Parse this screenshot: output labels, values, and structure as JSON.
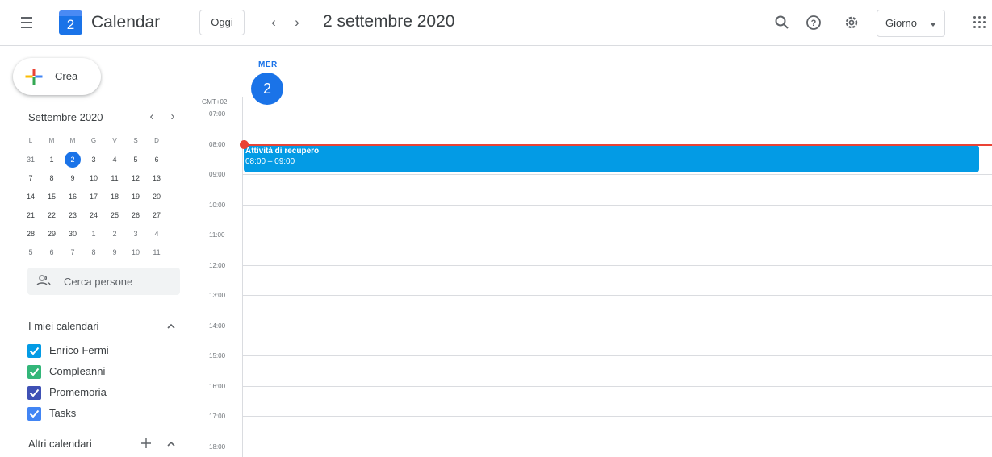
{
  "header": {
    "app_title": "Calendar",
    "logo_day": "2",
    "today_label": "Oggi",
    "date_title": "2 settembre 2020",
    "view_label": "Giorno",
    "icons": [
      "menu-icon",
      "search-icon",
      "help-icon",
      "gear-icon",
      "apps-grid-icon"
    ]
  },
  "sidebar": {
    "create_label": "Crea",
    "mini_calendar": {
      "title": "Settembre 2020",
      "weekdays": [
        "L",
        "M",
        "M",
        "G",
        "V",
        "S",
        "D"
      ],
      "weeks": [
        [
          "31",
          "1",
          "2",
          "3",
          "4",
          "5",
          "6"
        ],
        [
          "7",
          "8",
          "9",
          "10",
          "11",
          "12",
          "13"
        ],
        [
          "14",
          "15",
          "16",
          "17",
          "18",
          "19",
          "20"
        ],
        [
          "21",
          "22",
          "23",
          "24",
          "25",
          "26",
          "27"
        ],
        [
          "28",
          "29",
          "30",
          "1",
          "2",
          "3",
          "4"
        ],
        [
          "5",
          "6",
          "7",
          "8",
          "9",
          "10",
          "11"
        ]
      ],
      "selected": "2"
    },
    "people_search_placeholder": "Cerca persone",
    "my_calendars_title": "I miei calendari",
    "my_calendars": [
      {
        "label": "Enrico Fermi",
        "color": "#039be5"
      },
      {
        "label": "Compleanni",
        "color": "#33b679"
      },
      {
        "label": "Promemoria",
        "color": "#3f51b5"
      },
      {
        "label": "Tasks",
        "color": "#4285f4"
      }
    ],
    "other_calendars_title": "Altri calendari"
  },
  "day_view": {
    "dow": "MER",
    "day_number": "2",
    "timezone": "GMT+02",
    "hours": [
      "07:00",
      "08:00",
      "09:00",
      "10:00",
      "11:00",
      "12:00",
      "13:00",
      "14:00",
      "15:00",
      "16:00",
      "17:00",
      "18:00"
    ],
    "event": {
      "title": "Attività di recupero",
      "time": "08:00 – 09:00",
      "color": "#039be5"
    },
    "now_color": "#ea4335"
  }
}
